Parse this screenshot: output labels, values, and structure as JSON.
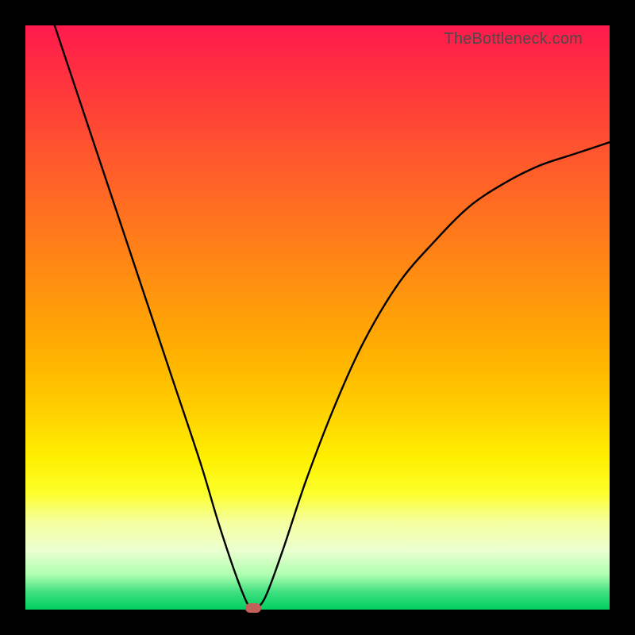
{
  "attribution": "TheBottleneck.com",
  "chart_data": {
    "type": "line",
    "title": "",
    "xlabel": "",
    "ylabel": "",
    "xlim": [
      0,
      100
    ],
    "ylim": [
      0,
      100
    ],
    "grid": false,
    "curve": [
      {
        "x": 5,
        "y": 100
      },
      {
        "x": 10,
        "y": 85
      },
      {
        "x": 15,
        "y": 70
      },
      {
        "x": 20,
        "y": 55
      },
      {
        "x": 25,
        "y": 40
      },
      {
        "x": 30,
        "y": 25
      },
      {
        "x": 33,
        "y": 15
      },
      {
        "x": 36,
        "y": 6
      },
      {
        "x": 38,
        "y": 1
      },
      {
        "x": 39,
        "y": 0
      },
      {
        "x": 41,
        "y": 2
      },
      {
        "x": 44,
        "y": 10
      },
      {
        "x": 48,
        "y": 22
      },
      {
        "x": 53,
        "y": 35
      },
      {
        "x": 58,
        "y": 46
      },
      {
        "x": 64,
        "y": 56
      },
      {
        "x": 70,
        "y": 63
      },
      {
        "x": 76,
        "y": 69
      },
      {
        "x": 82,
        "y": 73
      },
      {
        "x": 88,
        "y": 76
      },
      {
        "x": 94,
        "y": 78
      },
      {
        "x": 100,
        "y": 80
      }
    ],
    "marker": {
      "x": 39,
      "y": 0,
      "color": "#c06058"
    },
    "background_gradient": {
      "top": "#ff1a4d",
      "mid": "#ffe000",
      "bottom": "#00d060"
    }
  }
}
